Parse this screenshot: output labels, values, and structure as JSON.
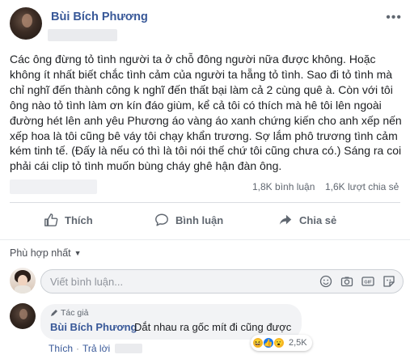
{
  "post": {
    "author": "Bùi Bích Phương",
    "more_label": "•••",
    "text": "Các ông đừng tỏ tình người ta ở chỗ đông người nữa được không. Hoặc không ít nhất biết chắc tình cảm của người ta hẵng tỏ tình. Sao đi tỏ tình mà chỉ nghĩ đến thành công k nghĩ đến thất bại làm cả 2 cùng quê à. Còn với tôi ông nào tỏ tình làm ơn kín đáo giùm, kể cả tôi có thích mà hê tôi lên ngoài đường hét lên anh yêu Phương áo vàng áo xanh chứng kiến cho anh xếp nến xếp hoa là tôi cũng bê váy tôi chạy khẩn trương. Sợ lắm phô trương tình cảm kém tinh tế. (Đấy là nếu có thì là tôi nói thế chứ tôi cũng chưa có.) Sáng ra coi phải cái clip tỏ tình muốn bùng cháy ghê hận đàn ông."
  },
  "stats": {
    "comments": "1,8K bình luận",
    "shares": "1,6K lượt chia sẻ"
  },
  "actions": {
    "like": "Thích",
    "comment": "Bình luận",
    "share": "Chia sẻ"
  },
  "sort": {
    "label": "Phù hợp nhất"
  },
  "comment_input": {
    "placeholder": "Viết bình luận...",
    "icons": [
      "emoji-icon",
      "camera-icon",
      "gif-icon",
      "sticker-icon"
    ]
  },
  "comment": {
    "badge": "Tác giả",
    "author": "Bùi Bích Phương",
    "text": "Dắt nhau ra gốc mít đi cũng được",
    "reaction_count": "2,5K",
    "like_label": "Thích",
    "reply_label": "Trả lời",
    "separator": "·"
  },
  "colors": {
    "link": "#385898",
    "secondary_text": "#606770",
    "divider": "#dadde1"
  }
}
